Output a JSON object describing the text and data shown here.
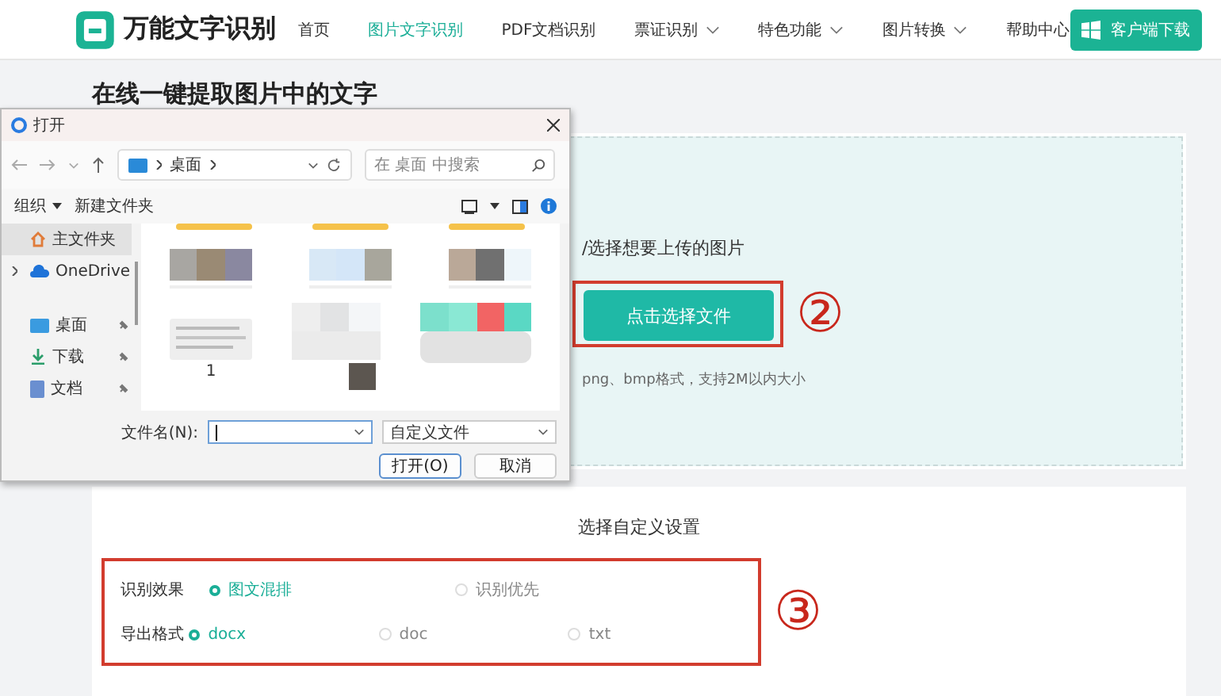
{
  "header": {
    "logo": "万能文字识别",
    "nav": [
      {
        "label": "首页",
        "selected": false,
        "has_menu": false
      },
      {
        "label": "图片文字识别",
        "selected": true,
        "has_menu": false
      },
      {
        "label": "PDF文档识别",
        "selected": false,
        "has_menu": false
      },
      {
        "label": "票证识别",
        "selected": false,
        "has_menu": true
      },
      {
        "label": "特色功能",
        "selected": false,
        "has_menu": true
      },
      {
        "label": "图片转换",
        "selected": false,
        "has_menu": true
      },
      {
        "label": "帮助中心",
        "selected": false,
        "has_menu": false
      }
    ],
    "download_button": "客户端下载"
  },
  "page_title": "在线一键提取图片中的文字",
  "upload": {
    "prompt": "/选择想要上传的图片",
    "button": "点击选择文件",
    "hint": "png、bmp格式，支持2M以内大小",
    "annotation": "②"
  },
  "settings": {
    "title": "选择自定义设置",
    "annotation": "③",
    "rows": [
      {
        "label": "识别效果",
        "options": [
          {
            "label": "图文混排",
            "selected": true
          },
          {
            "label": "识别优先",
            "selected": false
          }
        ]
      },
      {
        "label": "导出格式",
        "options": [
          {
            "label": "docx",
            "selected": true
          },
          {
            "label": "doc",
            "selected": false
          },
          {
            "label": "txt",
            "selected": false
          }
        ]
      }
    ]
  },
  "dialog": {
    "title": "打开",
    "address": "桌面",
    "search_placeholder": "在 桌面 中搜索",
    "toolbar": [
      "组织",
      "新建文件夹"
    ],
    "sidebar": [
      {
        "label": "主文件夹",
        "kind": "home",
        "selected": true
      },
      {
        "label": "OneDrive",
        "kind": "cloud",
        "selected": false
      },
      {
        "label": "桌面",
        "kind": "desktop",
        "selected": false
      },
      {
        "label": "下载",
        "kind": "download",
        "selected": false
      },
      {
        "label": "文档",
        "kind": "document",
        "selected": false
      }
    ],
    "file_caption": "1",
    "file_name_label": "文件名(N):",
    "file_type": "自定义文件",
    "buttons": [
      "打开(O)",
      "取消"
    ]
  }
}
